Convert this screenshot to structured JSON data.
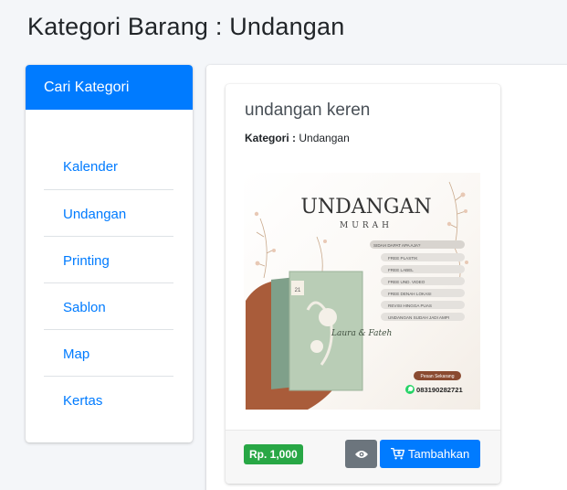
{
  "page": {
    "title": "Kategori Barang : Undangan"
  },
  "sidebar": {
    "header": "Cari Kategori",
    "items": [
      {
        "label": "Kalender"
      },
      {
        "label": "Undangan"
      },
      {
        "label": "Printing"
      },
      {
        "label": "Sablon"
      },
      {
        "label": "Map"
      },
      {
        "label": "Kertas"
      }
    ]
  },
  "product": {
    "name": "undangan keren",
    "category_label": "Kategori :",
    "category_value": "Undangan",
    "image": {
      "heading": "UNDANGAN",
      "subheading": "MURAH",
      "promo_title": "SIDAH DAPAT APA AJA?",
      "features": [
        "FREE PLASTIK",
        "FREE LABEL",
        "FREE UND. VIDEO",
        "FREE DENAH LOKASI",
        "REVISI HINGGA PUAS",
        "UNDANGAN SUDAH JADI AMPI"
      ],
      "cta": "Pesan Sekarang",
      "phone": "083190282721",
      "book_names": "Laura & Fateh",
      "book_date": "21"
    },
    "price": "Rp. 1,000",
    "add_button": "Tambahkan"
  },
  "colors": {
    "primary": "#007bff",
    "success": "#28a745",
    "secondary": "#6c757d",
    "background": "#f4f6f9"
  }
}
